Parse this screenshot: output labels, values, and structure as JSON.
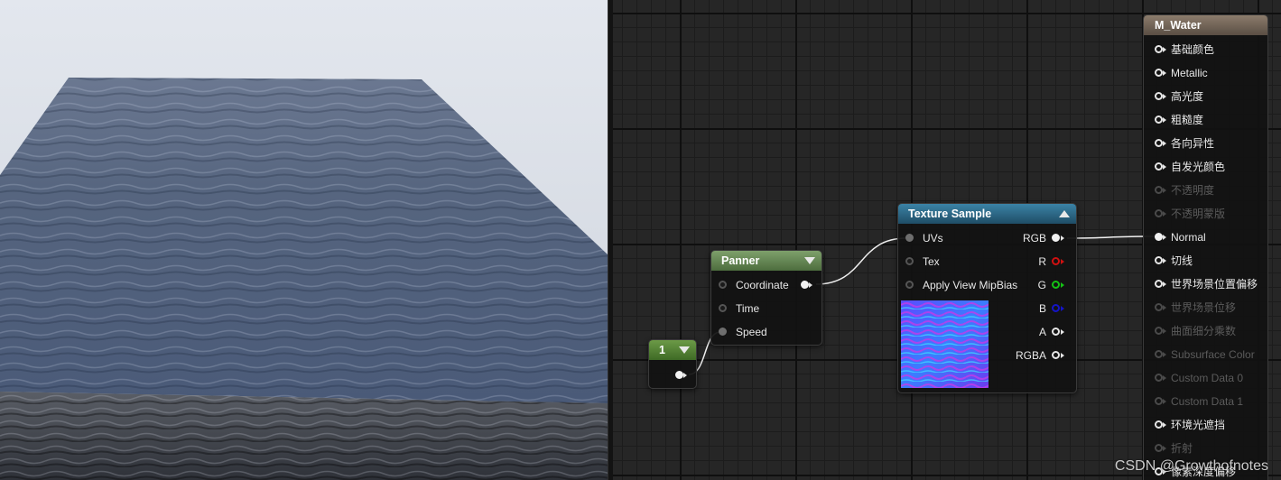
{
  "viewport": {
    "sky_color": "#dde1e8",
    "water_color": "#56657f"
  },
  "nodes": {
    "constant": {
      "title": "1",
      "header_color": "#5d8a3c"
    },
    "panner": {
      "title": "Panner",
      "header_color": "#6b8c5a",
      "inputs": [
        "Coordinate",
        "Time",
        "Speed"
      ]
    },
    "texture_sample": {
      "title": "Texture Sample",
      "header_color": "#2e6a86",
      "inputs": [
        "UVs",
        "Tex",
        "Apply View MipBias"
      ],
      "outputs": [
        "RGB",
        "R",
        "G",
        "B",
        "A",
        "RGBA"
      ]
    },
    "result": {
      "title": "M_Water",
      "pins": [
        {
          "label": "基础颜色",
          "enabled": true
        },
        {
          "label": "Metallic",
          "enabled": true
        },
        {
          "label": "高光度",
          "enabled": true
        },
        {
          "label": "粗糙度",
          "enabled": true
        },
        {
          "label": "各向异性",
          "enabled": true
        },
        {
          "label": "自发光颜色",
          "enabled": true
        },
        {
          "label": "不透明度",
          "enabled": false
        },
        {
          "label": "不透明蒙版",
          "enabled": false
        },
        {
          "label": "Normal",
          "enabled": true,
          "connected": true
        },
        {
          "label": "切线",
          "enabled": true
        },
        {
          "label": "世界场景位置偏移",
          "enabled": true
        },
        {
          "label": "世界场景位移",
          "enabled": false
        },
        {
          "label": "曲面细分乘数",
          "enabled": false
        },
        {
          "label": "Subsurface Color",
          "enabled": false
        },
        {
          "label": "Custom Data 0",
          "enabled": false
        },
        {
          "label": "Custom Data 1",
          "enabled": false
        },
        {
          "label": "环境光遮挡",
          "enabled": true
        },
        {
          "label": "折射",
          "enabled": false
        },
        {
          "label": "像素深度偏移",
          "enabled": true
        }
      ]
    }
  },
  "watermark": "CSDN @Growthofnotes"
}
